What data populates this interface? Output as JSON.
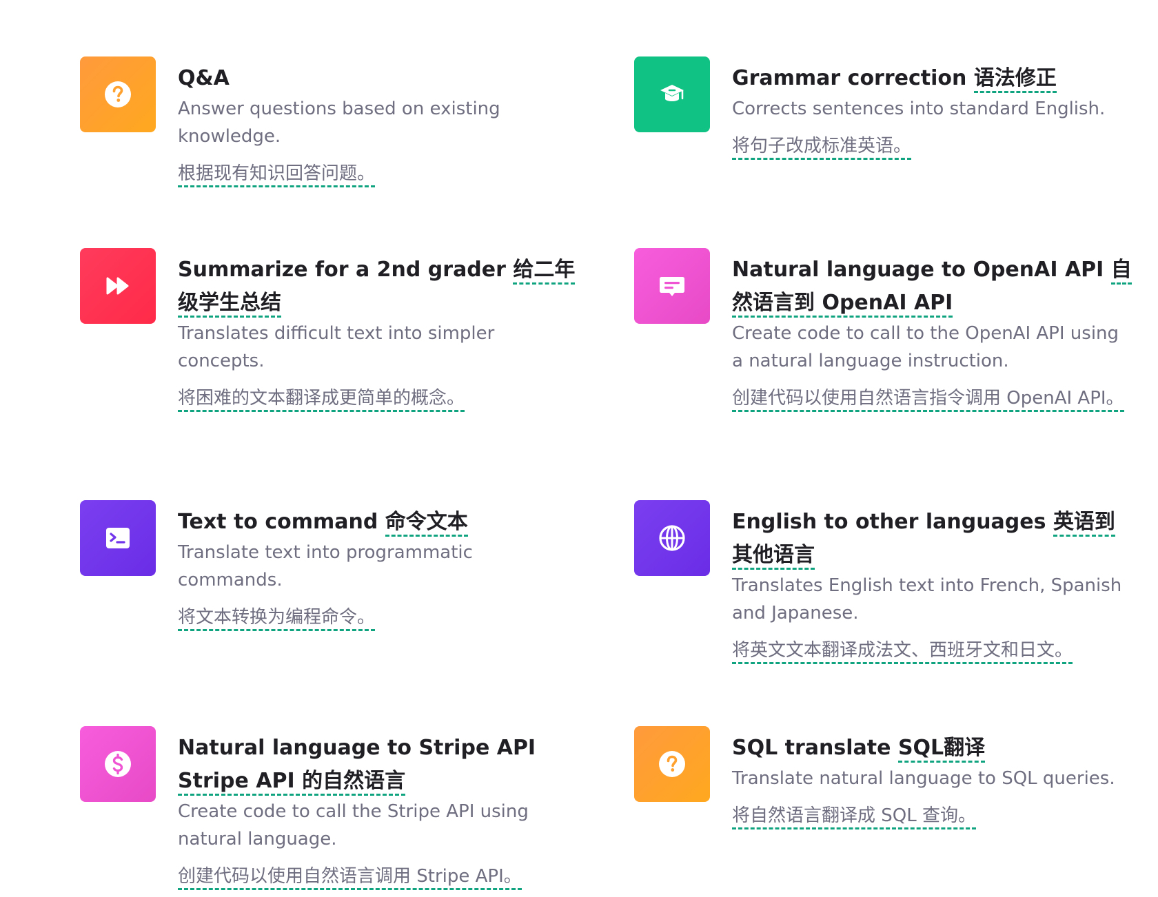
{
  "colors": {
    "accent_underline": "#10a37f",
    "orange": "#ffa12e",
    "green": "#10c283",
    "red": "#ff2e52",
    "pink": "#ef54d2",
    "purple": "#7236eb"
  },
  "cards": [
    {
      "icon": "question-circle-icon",
      "color": "orange",
      "title_en": "Q&A",
      "title_zh": "",
      "desc_en": "Answer questions based on existing knowledge.",
      "desc_zh": "根据现有知识回答问题。"
    },
    {
      "icon": "graduation-cap-icon",
      "color": "green",
      "title_en": "Grammar correction ",
      "title_zh": "语法修正",
      "desc_en": "Corrects sentences into standard English.",
      "desc_zh": "将句子改成标准英语。"
    },
    {
      "icon": "fast-forward-icon",
      "color": "red",
      "title_en": "Summarize for a 2nd grader ",
      "title_zh": "给二年级学生总结",
      "desc_en": "Translates difficult text into simpler concepts.",
      "desc_zh": "将困难的文本翻译成更简单的概念。"
    },
    {
      "icon": "message-icon",
      "color": "pink",
      "title_en": "Natural language to OpenAI API ",
      "title_zh": "自然语言到 OpenAI API",
      "desc_en": "Create code to call to the OpenAI API using a natural language instruction.",
      "desc_zh": "创建代码以使用自然语言指令调用 OpenAI API。"
    },
    {
      "icon": "terminal-icon",
      "color": "purple",
      "title_en": "Text to command ",
      "title_zh": "命令文本",
      "desc_en": "Translate text into programmatic commands.",
      "desc_zh": "将文本转换为编程命令。"
    },
    {
      "icon": "globe-icon",
      "color": "purple",
      "title_en": "English to other languages ",
      "title_zh": "英语到其他语言",
      "desc_en": "Translates English text into French, Spanish and Japanese.",
      "desc_zh": "将英文文本翻译成法文、西班牙文和日文。"
    },
    {
      "icon": "dollar-circle-icon",
      "color": "pink",
      "title_en": "Natural language to Stripe API ",
      "title_zh": "Stripe API 的自然语言",
      "desc_en": "Create code to call the Stripe API using natural language.",
      "desc_zh": "创建代码以使用自然语言调用 Stripe API。"
    },
    {
      "icon": "question-circle-icon",
      "color": "orange",
      "title_en": "SQL translate ",
      "title_zh": "SQL翻译",
      "desc_en": "Translate natural language to SQL queries.",
      "desc_zh": "将自然语言翻译成 SQL 查询。"
    }
  ]
}
